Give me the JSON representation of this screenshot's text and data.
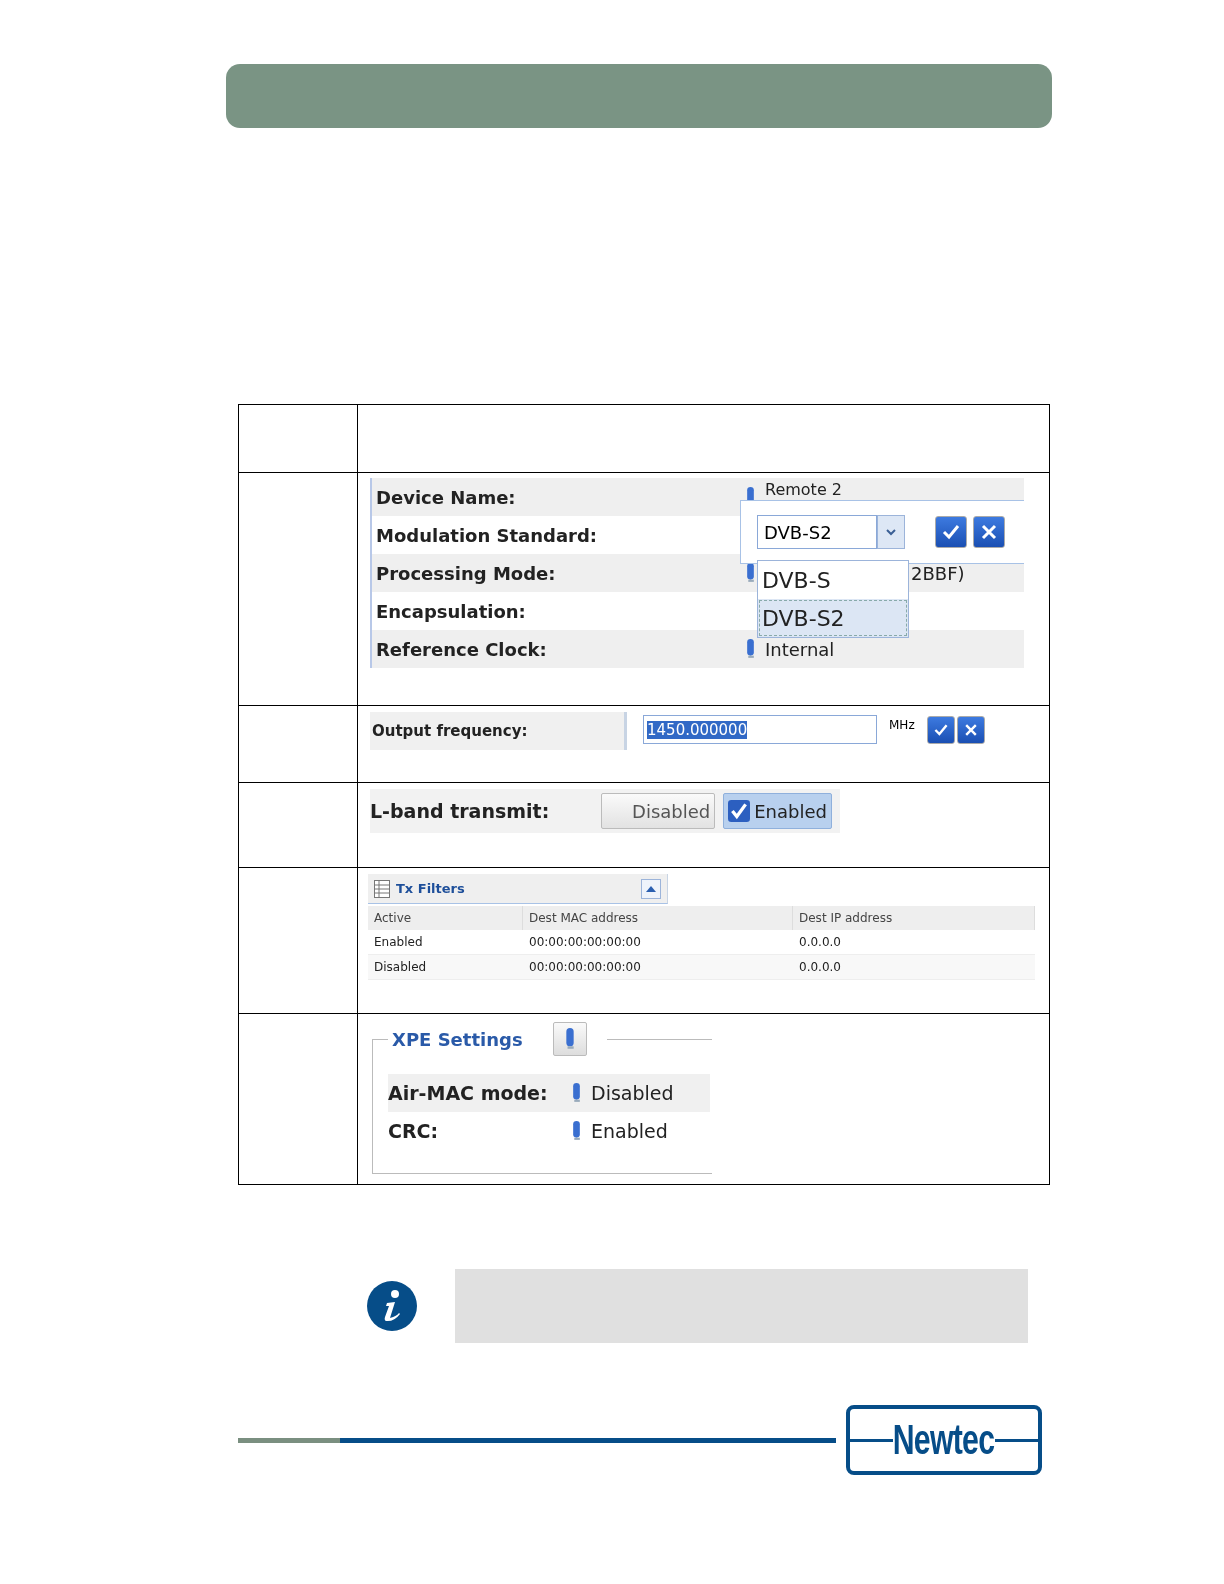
{
  "device_settings": {
    "rows": [
      {
        "label": "Device Name:",
        "value": "Remote 2"
      },
      {
        "label": "Modulation Standard:",
        "value": ""
      },
      {
        "label": "Processing Mode:",
        "value": "2BBF)"
      },
      {
        "label": "Encapsulation:",
        "value": ""
      },
      {
        "label": "Reference Clock:",
        "value": "Internal"
      }
    ],
    "editor": {
      "value": "DVB-S2",
      "options": [
        {
          "label": "DVB-S",
          "selected": false
        },
        {
          "label": "DVB-S2",
          "selected": true
        }
      ]
    }
  },
  "output_frequency": {
    "label": "Output frequency:",
    "value": "1450.000000",
    "unit": "MHz"
  },
  "lband": {
    "label": "L-band transmit:",
    "options": [
      {
        "label": "Disabled",
        "selected": false
      },
      {
        "label": "Enabled",
        "selected": true
      }
    ]
  },
  "tx_filters": {
    "title": "Tx Filters",
    "columns": [
      "Active",
      "Dest MAC address",
      "Dest IP address"
    ],
    "rows": [
      [
        "Enabled",
        "00:00:00:00:00:00",
        "0.0.0.0"
      ],
      [
        "Disabled",
        "00:00:00:00:00:00",
        "0.0.0.0"
      ]
    ]
  },
  "xpe_settings": {
    "title": "XPE Settings",
    "rows": [
      {
        "label": "Air-MAC mode:",
        "value": "Disabled"
      },
      {
        "label": "CRC:",
        "value": "Enabled"
      }
    ]
  },
  "logo": {
    "text": "Newtec"
  }
}
